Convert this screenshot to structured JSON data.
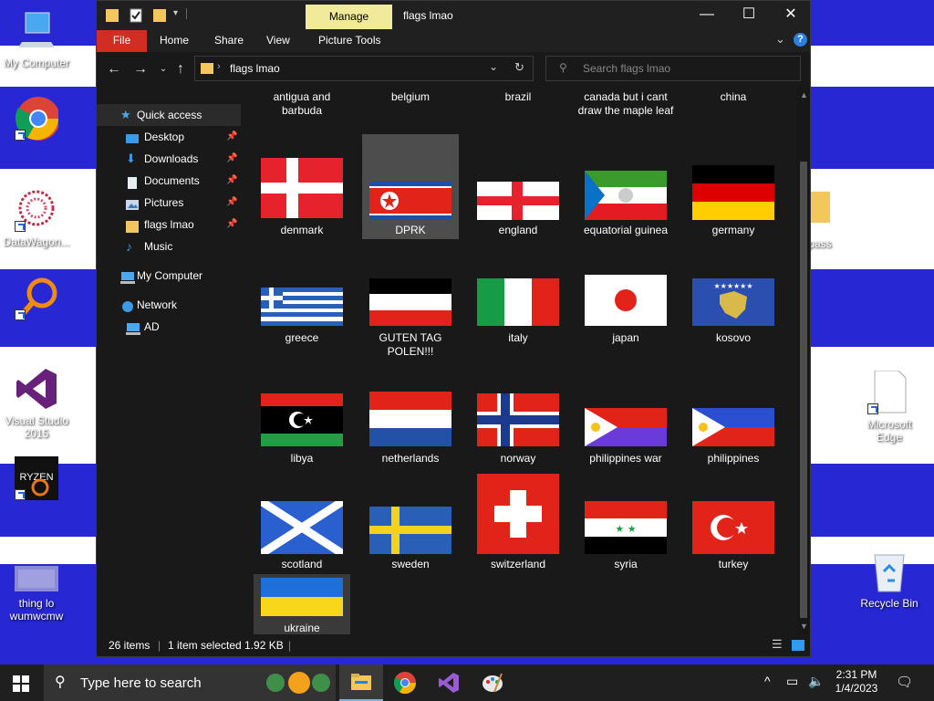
{
  "desktop": {
    "colors": {
      "blue": "#2727d4",
      "white": "#ffffff"
    },
    "icons": [
      {
        "label": "My Computer",
        "icon": "computer-icon"
      },
      {
        "label": "",
        "icon": "chrome-icon"
      },
      {
        "label": "DataWagon...",
        "icon": "datawagon-icon"
      },
      {
        "label": "",
        "icon": "magnifier-app-icon"
      },
      {
        "label": "Visual Studio 2015",
        "icon": "visual-studio-icon"
      },
      {
        "label": "",
        "icon": "ryzen-icon"
      },
      {
        "label": "thing lo wumwcmw",
        "icon": "image-file-icon"
      },
      {
        "label": "ypass",
        "icon": "folder-icon"
      },
      {
        "label": "Microsoft Edge",
        "icon": "file-icon"
      },
      {
        "label": "Recycle Bin",
        "icon": "recycle-bin-icon"
      }
    ]
  },
  "window": {
    "title": "flags lmao",
    "manage_tab": "Manage",
    "ribbon_tabs": [
      "File",
      "Home",
      "Share",
      "View",
      "Picture Tools"
    ],
    "controls": {
      "minimize": "—",
      "maximize": "☐",
      "close": "✕"
    },
    "colors": {
      "bg": "#191919",
      "file_tab": "#d12d23",
      "manage": "#f1ea9b",
      "accent": "#2f9cf0"
    }
  },
  "navigation": {
    "address": "flags lmao",
    "search_placeholder": "Search flags lmao"
  },
  "nav_pane": {
    "quick_access": "Quick access",
    "items": [
      {
        "label": "Desktop",
        "pinned": true
      },
      {
        "label": "Downloads",
        "pinned": true
      },
      {
        "label": "Documents",
        "pinned": true
      },
      {
        "label": "Pictures",
        "pinned": true
      },
      {
        "label": "flags lmao",
        "pinned": true
      },
      {
        "label": "Music",
        "pinned": false
      }
    ],
    "my_computer": "My Computer",
    "network": "Network",
    "network_child": "AD"
  },
  "files": {
    "partial_row": [
      "antigua and barbuda",
      "belgium",
      "brazil",
      "canada but i cant draw the maple leaf",
      "china"
    ],
    "rows": [
      [
        "denmark",
        "DPRK",
        "england",
        "equatorial guinea",
        "germany"
      ],
      [
        "greece",
        "GUTEN TAG POLEN!!!",
        "italy",
        "japan",
        "kosovo"
      ],
      [
        "libya",
        "netherlands",
        "norway",
        "philippines war",
        "philippines"
      ],
      [
        "scotland",
        "sweden",
        "switzerland",
        "syria",
        "turkey"
      ],
      [
        "ukraine"
      ]
    ],
    "selected": "DPRK",
    "selected_color": "#4d4d4d"
  },
  "status": {
    "items": "26 items",
    "selection": "1 item selected  1.92 KB"
  },
  "taskbar": {
    "search_placeholder": "Type here to search",
    "time": "2:31 PM",
    "date": "1/4/2023",
    "apps": [
      "file-explorer-icon",
      "chrome-icon",
      "visual-studio-icon",
      "paint-icon"
    ]
  }
}
